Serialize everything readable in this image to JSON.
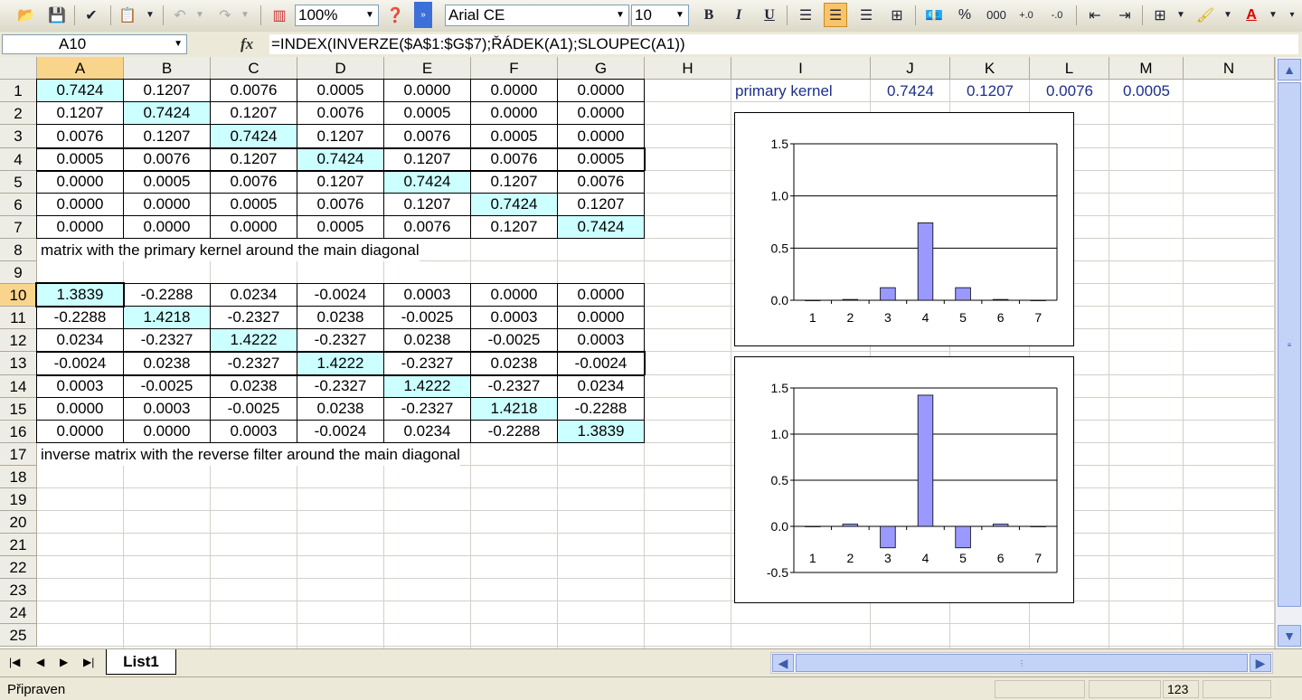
{
  "toolbar": {
    "zoom": "100%",
    "font_name": "Arial CE",
    "font_size": "10",
    "bold_label": "B",
    "italic_label": "I",
    "underline_label": "U",
    "percent_label": "%",
    "thousands_label": "000"
  },
  "formula_bar": {
    "name_box": "A10",
    "fx_label": "fx",
    "formula": "=INDEX(INVERZE($A$1:$G$7);ŘÁDEK(A1);SLOUPEC(A1))"
  },
  "columns": [
    "A",
    "B",
    "C",
    "D",
    "E",
    "F",
    "G",
    "H",
    "I",
    "J",
    "K",
    "L",
    "M",
    "N"
  ],
  "rows": [
    "1",
    "2",
    "3",
    "4",
    "5",
    "6",
    "7",
    "8",
    "9",
    "10",
    "11",
    "12",
    "13",
    "14",
    "15",
    "16",
    "17",
    "18",
    "19",
    "20",
    "21",
    "22",
    "23",
    "24",
    "25"
  ],
  "matrix1": [
    [
      "0.7424",
      "0.1207",
      "0.0076",
      "0.0005",
      "0.0000",
      "0.0000",
      "0.0000"
    ],
    [
      "0.1207",
      "0.7424",
      "0.1207",
      "0.0076",
      "0.0005",
      "0.0000",
      "0.0000"
    ],
    [
      "0.0076",
      "0.1207",
      "0.7424",
      "0.1207",
      "0.0076",
      "0.0005",
      "0.0000"
    ],
    [
      "0.0005",
      "0.0076",
      "0.1207",
      "0.7424",
      "0.1207",
      "0.0076",
      "0.0005"
    ],
    [
      "0.0000",
      "0.0005",
      "0.0076",
      "0.1207",
      "0.7424",
      "0.1207",
      "0.0076"
    ],
    [
      "0.0000",
      "0.0000",
      "0.0005",
      "0.0076",
      "0.1207",
      "0.7424",
      "0.1207"
    ],
    [
      "0.0000",
      "0.0000",
      "0.0000",
      "0.0005",
      "0.0076",
      "0.1207",
      "0.7424"
    ]
  ],
  "matrix1_caption": "matrix with the primary kernel around the main diagonal",
  "matrix2": [
    [
      "1.3839",
      "-0.2288",
      "0.0234",
      "-0.0024",
      "0.0003",
      "0.0000",
      "0.0000"
    ],
    [
      "-0.2288",
      "1.4218",
      "-0.2327",
      "0.0238",
      "-0.0025",
      "0.0003",
      "0.0000"
    ],
    [
      "0.0234",
      "-0.2327",
      "1.4222",
      "-0.2327",
      "0.0238",
      "-0.0025",
      "0.0003"
    ],
    [
      "-0.0024",
      "0.0238",
      "-0.2327",
      "1.4222",
      "-0.2327",
      "0.0238",
      "-0.0024"
    ],
    [
      "0.0003",
      "-0.0025",
      "0.0238",
      "-0.2327",
      "1.4222",
      "-0.2327",
      "0.0234"
    ],
    [
      "0.0000",
      "0.0003",
      "-0.0025",
      "0.0238",
      "-0.2327",
      "1.4218",
      "-0.2288"
    ],
    [
      "0.0000",
      "0.0000",
      "0.0003",
      "-0.0024",
      "0.0234",
      "-0.2288",
      "1.3839"
    ]
  ],
  "matrix2_caption": "inverse matrix with the reverse filter around the main diagonal",
  "kernel_row": {
    "label": "primary kernel",
    "values": [
      "0.7424",
      "0.1207",
      "0.0076",
      "0.0005"
    ]
  },
  "chart_data": [
    {
      "type": "bar",
      "categories": [
        "1",
        "2",
        "3",
        "4",
        "5",
        "6",
        "7"
      ],
      "values": [
        0.0,
        0.0076,
        0.1207,
        0.7424,
        0.1207,
        0.0076,
        0.0
      ],
      "ylim": [
        0,
        1.5
      ],
      "yticks": [
        "0.0",
        "0.5",
        "1.0",
        "1.5"
      ],
      "grid": true,
      "bar_color": "#9999ff"
    },
    {
      "type": "bar",
      "categories": [
        "1",
        "2",
        "3",
        "4",
        "5",
        "6",
        "7"
      ],
      "values": [
        0.0003,
        0.0238,
        -0.2327,
        1.4222,
        -0.2327,
        0.0238,
        0.0003
      ],
      "ylim": [
        -0.5,
        1.5
      ],
      "yticks": [
        "-0.5",
        "0.0",
        "0.5",
        "1.0",
        "1.5"
      ],
      "grid": true,
      "bar_color": "#9999ff"
    }
  ],
  "sheet_tab": "List1",
  "status": {
    "text": "Připraven",
    "num": "123"
  },
  "colors": {
    "highlight": "#ccffff",
    "selected_header": "#f9d58c",
    "kernel_text": "#1c2f8b"
  }
}
